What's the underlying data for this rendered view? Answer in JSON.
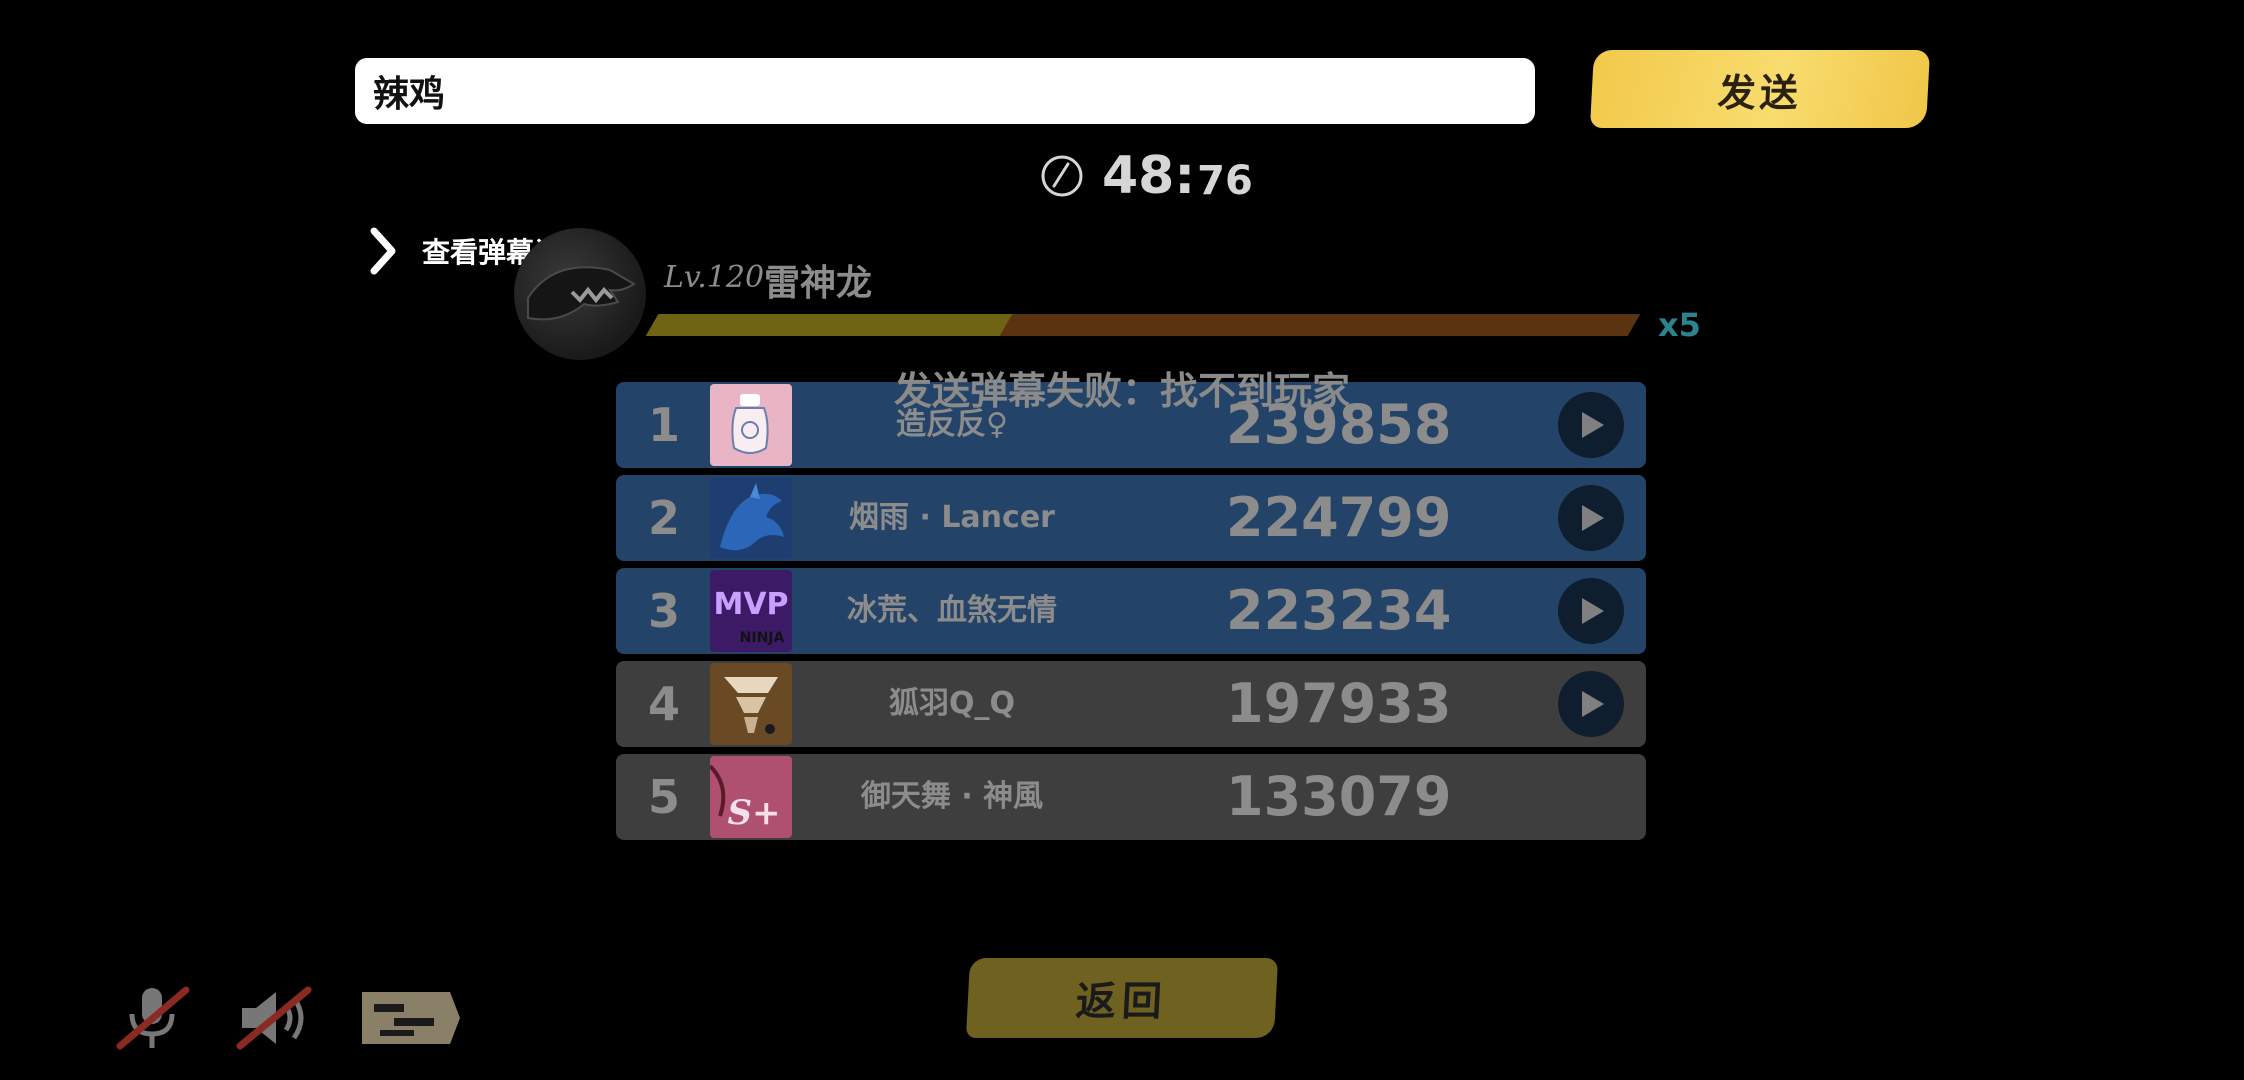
{
  "chat": {
    "input_value": "辣鸡",
    "send_label": "发送"
  },
  "timer": {
    "main": "48:",
    "fraction": "76"
  },
  "history_link": {
    "label": "查看弹幕记录"
  },
  "boss": {
    "level": "Lv.120",
    "name": "雷神龙",
    "hp_fraction": 0.36,
    "multiplier": "x5"
  },
  "toast": {
    "message": "发送弹幕失败：找不到玩家"
  },
  "leaderboard": [
    {
      "rank": "1",
      "name": "造反反♀",
      "score": "239858",
      "has_replay": true,
      "style": "blue"
    },
    {
      "rank": "2",
      "name": "烟雨 · Lancer",
      "score": "224799",
      "has_replay": true,
      "style": "blue"
    },
    {
      "rank": "3",
      "name": "冰荒、血煞无情",
      "score": "223234",
      "has_replay": true,
      "style": "blue"
    },
    {
      "rank": "4",
      "name": "狐羽Q_Q",
      "score": "197933",
      "has_replay": true,
      "style": "grey"
    },
    {
      "rank": "5",
      "name": "御天舞 · 神風",
      "score": "133079",
      "has_replay": false,
      "style": "grey"
    }
  ],
  "avatars": [
    "bottle-avatar",
    "blue-dragon-avatar",
    "mvp-ninja-avatar",
    "tornado-avatar",
    "sakura-s-avatar"
  ],
  "avatar_texts": {
    "mvp": "MVP",
    "ninja": "NINJA",
    "s_plus": "S+"
  },
  "back": {
    "label": "返回"
  },
  "controls": {
    "icons": [
      "microphone-muted-icon",
      "speaker-muted-icon",
      "danmaku-toggle-icon"
    ]
  },
  "colors": {
    "send_button": "#f8dc6e",
    "row_blue": "#234468",
    "row_grey": "#3e3e3e",
    "hp_filled": "#6e6413",
    "hp_empty": "#5a3410",
    "multiplier": "#2d8290"
  }
}
